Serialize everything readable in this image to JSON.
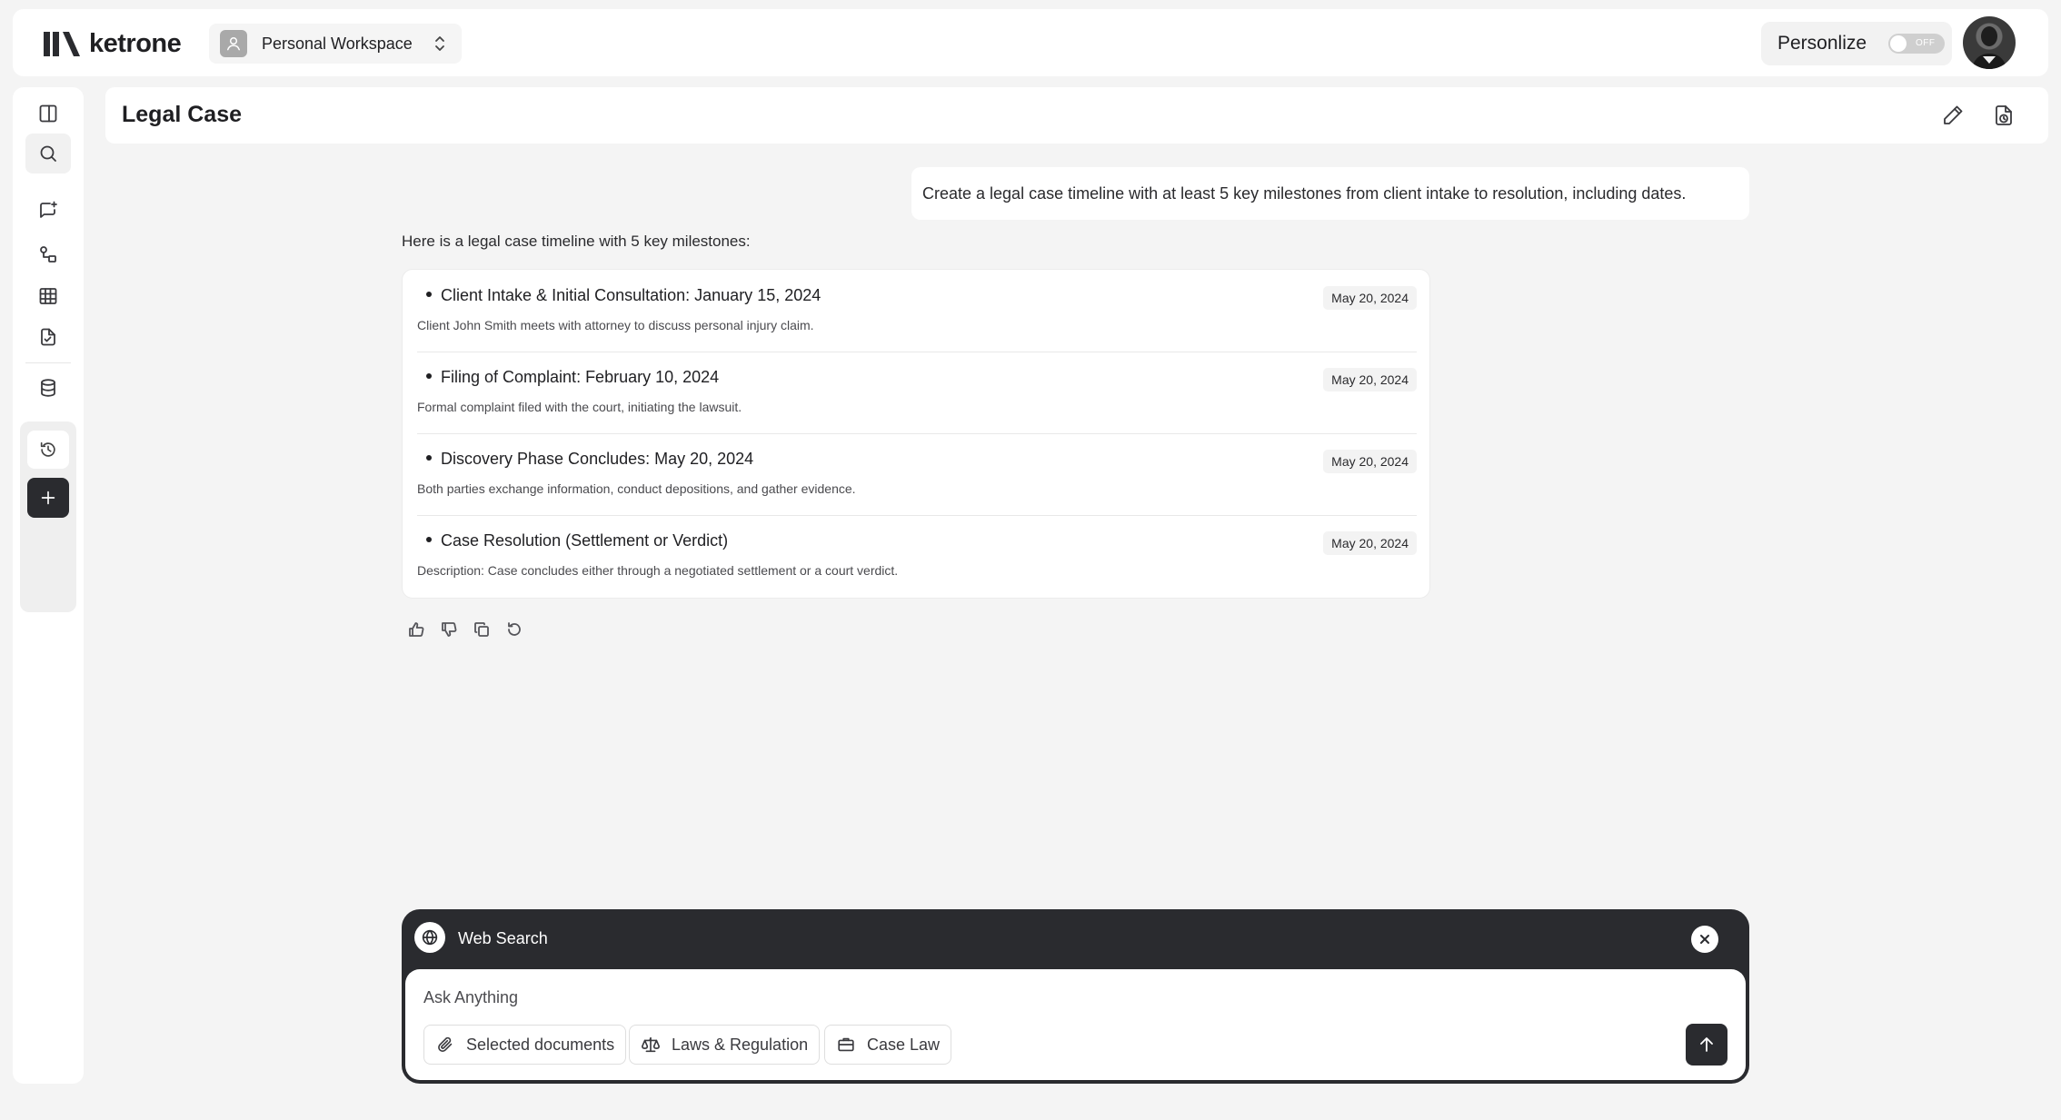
{
  "brand": {
    "name": "ketrone"
  },
  "workspace": {
    "label": "Personal Workspace"
  },
  "personalize": {
    "label": "Personlize",
    "toggle_state": "OFF"
  },
  "header": {
    "title": "Legal Case"
  },
  "sidebar": {
    "items": [
      {
        "name": "toggle-sidebar",
        "icon": "sidebar-panel-icon"
      },
      {
        "name": "search",
        "icon": "search-icon"
      },
      {
        "name": "new-chat",
        "icon": "chat-sparkle-icon"
      },
      {
        "name": "workflows",
        "icon": "workflow-icon"
      },
      {
        "name": "tables",
        "icon": "table-grid-icon"
      },
      {
        "name": "documents",
        "icon": "document-check-icon"
      },
      {
        "name": "database",
        "icon": "database-icon"
      },
      {
        "name": "history",
        "icon": "history-icon"
      },
      {
        "name": "add",
        "icon": "plus-icon"
      }
    ]
  },
  "conversation": {
    "user_message": "Create a legal case timeline with at least 5 key milestones from client intake to resolution, including dates.",
    "assistant_intro": "Here is a legal case timeline with 5 key milestones:",
    "milestones": [
      {
        "title": "Client Intake & Initial Consultation: January 15, 2024",
        "description": "Client John Smith meets with attorney to discuss personal injury claim.",
        "date": "May 20, 2024"
      },
      {
        "title": "Filing of Complaint: February 10, 2024",
        "description": "Formal complaint filed with the court, initiating the lawsuit.",
        "date": "May 20, 2024"
      },
      {
        "title": "Discovery Phase Concludes: May 20, 2024",
        "description": "Both parties exchange information, conduct depositions, and gather evidence.",
        "date": "May 20, 2024"
      },
      {
        "title": "Case Resolution (Settlement or Verdict)",
        "description": "Description: Case concludes either through a negotiated settlement or a court verdict.",
        "date": "May 20, 2024"
      }
    ]
  },
  "composer": {
    "mode_label": "Web Search",
    "placeholder": "Ask Anything",
    "chips": [
      "Selected documents",
      "Laws & Regulation",
      "Case Law"
    ]
  },
  "colors": {
    "dark": "#2a2b2f",
    "background": "#f4f4f4",
    "surface": "#ffffff"
  }
}
